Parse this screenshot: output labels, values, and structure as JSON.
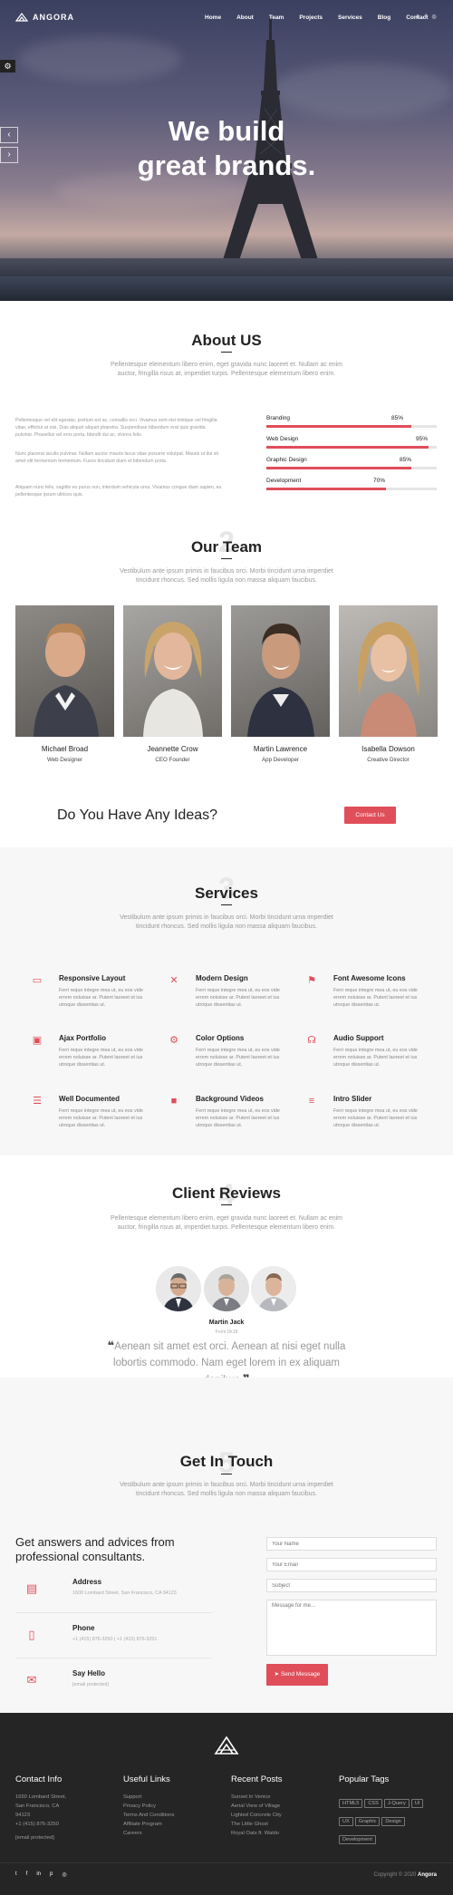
{
  "brand": {
    "name": "ANGORA"
  },
  "nav": {
    "items": [
      "Home",
      "About",
      "Team",
      "Projects",
      "Services",
      "Blog",
      "Contact"
    ],
    "social_icons": [
      "twitter-icon",
      "facebook-icon",
      "instagram-icon"
    ]
  },
  "hero": {
    "line1": "We build",
    "line2": "great brands."
  },
  "about": {
    "title": "About US",
    "lead": "Pellentesque elementum libero enim, eget gravida nunc laoreet et. Nullam ac enim auctor, fringilla risus at, imperdiet turpis. Pellentesque elementum libero enim.",
    "paragraphs": [
      "Pellentesque vel elit egestas, pretium est ac, convallis orci. Vivamus sem nisi tristique vel fringilla vitae, efficitur at nisi. Duis aliquet aliquet pharetra. Suspendisse bibendum erat quis gravida pulvinar. Phasellus vel eros porta, blandit dui ac, viverra felis.",
      "Nunc placerat iaculis pulvinar. Nullam auctor mauris lacus vitae posuere volutpat. Mauris ut dui sit amet elit fermentum fermentum. Fusce tincidunt diam et bibendum porta.",
      "Aliquam nunc felis, sagittis eu purus non, interdum vehicula urna. Vivamus congue diam sapien, eu pellentesque ipsum ultrices quis."
    ],
    "skills": [
      {
        "label": "Branding",
        "value": 85,
        "value_text": "85%"
      },
      {
        "label": "Web Design",
        "value": 95,
        "value_text": "95%"
      },
      {
        "label": "Graphic Design",
        "value": 85,
        "value_text": "85%"
      },
      {
        "label": "Development",
        "value": 70,
        "value_text": "70%"
      }
    ]
  },
  "team": {
    "number": "2",
    "title": "Our Team",
    "lead": "Vestibulum ante ipsum primis in faucibus orci. Morbi tincidunt urna imperdiet tincidunt rhoncus. Sed mollis ligula non massa aliquam faucibus.",
    "members": [
      {
        "name": "Michael Broad",
        "role": "Web Designer"
      },
      {
        "name": "Jeannette Crow",
        "role": "CEO Founder"
      },
      {
        "name": "Martin Lawrence",
        "role": "App Developer"
      },
      {
        "name": "Isabella Dowson",
        "role": "Creative Director"
      }
    ]
  },
  "cta": {
    "question": "Do You Have Any Ideas?",
    "button": "Contact Us"
  },
  "services": {
    "number": "3",
    "title": "Services",
    "lead": "Vestibulum ante ipsum primis in faucibus orci. Morbi tincidunt urna imperdiet tincidunt rhoncus. Sed mollis ligula non massa aliquam faucibus.",
    "text": "Ferri reque integre mea ut, eu eos vide errem noluisse ar. Putent laoreet et ius utroque dissentias ut.",
    "items": [
      {
        "title": "Responsive Layout",
        "icon": "laptop-icon"
      },
      {
        "title": "Modern Design",
        "icon": "design-tools-icon"
      },
      {
        "title": "Font Awesome Icons",
        "icon": "flag-icon"
      },
      {
        "title": "Ajax Portfolio",
        "icon": "id-card-icon"
      },
      {
        "title": "Color Options",
        "icon": "gear-icon"
      },
      {
        "title": "Audio Support",
        "icon": "headset-icon"
      },
      {
        "title": "Well Documented",
        "icon": "list-icon"
      },
      {
        "title": "Background Videos",
        "icon": "video-camera-icon"
      },
      {
        "title": "Intro Slider",
        "icon": "sliders-icon"
      }
    ]
  },
  "reviews": {
    "number": "4",
    "title": "Client Reviews",
    "lead": "Pellentesque elementum libero enim, eget gravida nunc laoreet et. Nullam ac enim auctor, fringilla risus at, imperdiet turpis. Pellentesque elementum libero enim.",
    "reviewer": "Martin Jack",
    "reviewer_role": "From Uk18",
    "quote": "Aenean sit amet est orci. Aenean at nisi eget nulla lobortis commodo. Nam eget lorem in ex aliquam dapibus."
  },
  "contact": {
    "number": "5",
    "title": "Get In Touch",
    "lead": "Vestibulum ante ipsum primis in faucibus orci. Morbi tincidunt urna imperdiet tincidunt rhoncus. Sed mollis ligula non massa aliquam faucibus.",
    "heading": "Get answers and advices from professional consultants.",
    "items": [
      {
        "title": "Address",
        "detail": "1600 Lombard Street, San Francisco, CA 94123",
        "icon": "map-icon"
      },
      {
        "title": "Phone",
        "detail": "+1 (415) 876-3250 | +1 (415) 876-3251",
        "icon": "mobile-phone-icon"
      },
      {
        "title": "Say Hello",
        "detail": "[email protected]",
        "icon": "envelope-icon"
      }
    ],
    "form": {
      "name_placeholder": "Your Name",
      "email_placeholder": "Your Email",
      "subject_placeholder": "Subject",
      "message_placeholder": "Message for me...",
      "submit": "Send Message"
    },
    "accent_color": "#e04e5a"
  },
  "footer": {
    "contact_info": {
      "title": "Contact Info",
      "lines": [
        "1650 Lombard Street,",
        "San Francisco, CA",
        "94123",
        "+1 (415) 876-3250",
        "[email protected]"
      ]
    },
    "useful_links": {
      "title": "Useful Links",
      "lines": [
        "Support",
        "Privacy Policy",
        "Terms And Conditions",
        "Affiliate Program",
        "Careers"
      ]
    },
    "recent_posts": {
      "title": "Recent Posts",
      "lines": [
        "Sunset In Venice",
        "Aerial View of Village",
        "Lighted Concrete City",
        "The Little Ghost",
        "Royal Oats ft. Waldo"
      ]
    },
    "popular_tags": {
      "title": "Popular Tags",
      "tags": [
        "HTML5",
        "CSS",
        "J-Query",
        "UI",
        "UX",
        "Graphic",
        "Design",
        "Development"
      ]
    },
    "social_icons": [
      "twitter-icon",
      "facebook-icon",
      "linkedin-icon",
      "pinterest-icon",
      "instagram-icon"
    ],
    "copyright_prefix": "Copyright © 2020",
    "copyright_brand": "Angora"
  }
}
